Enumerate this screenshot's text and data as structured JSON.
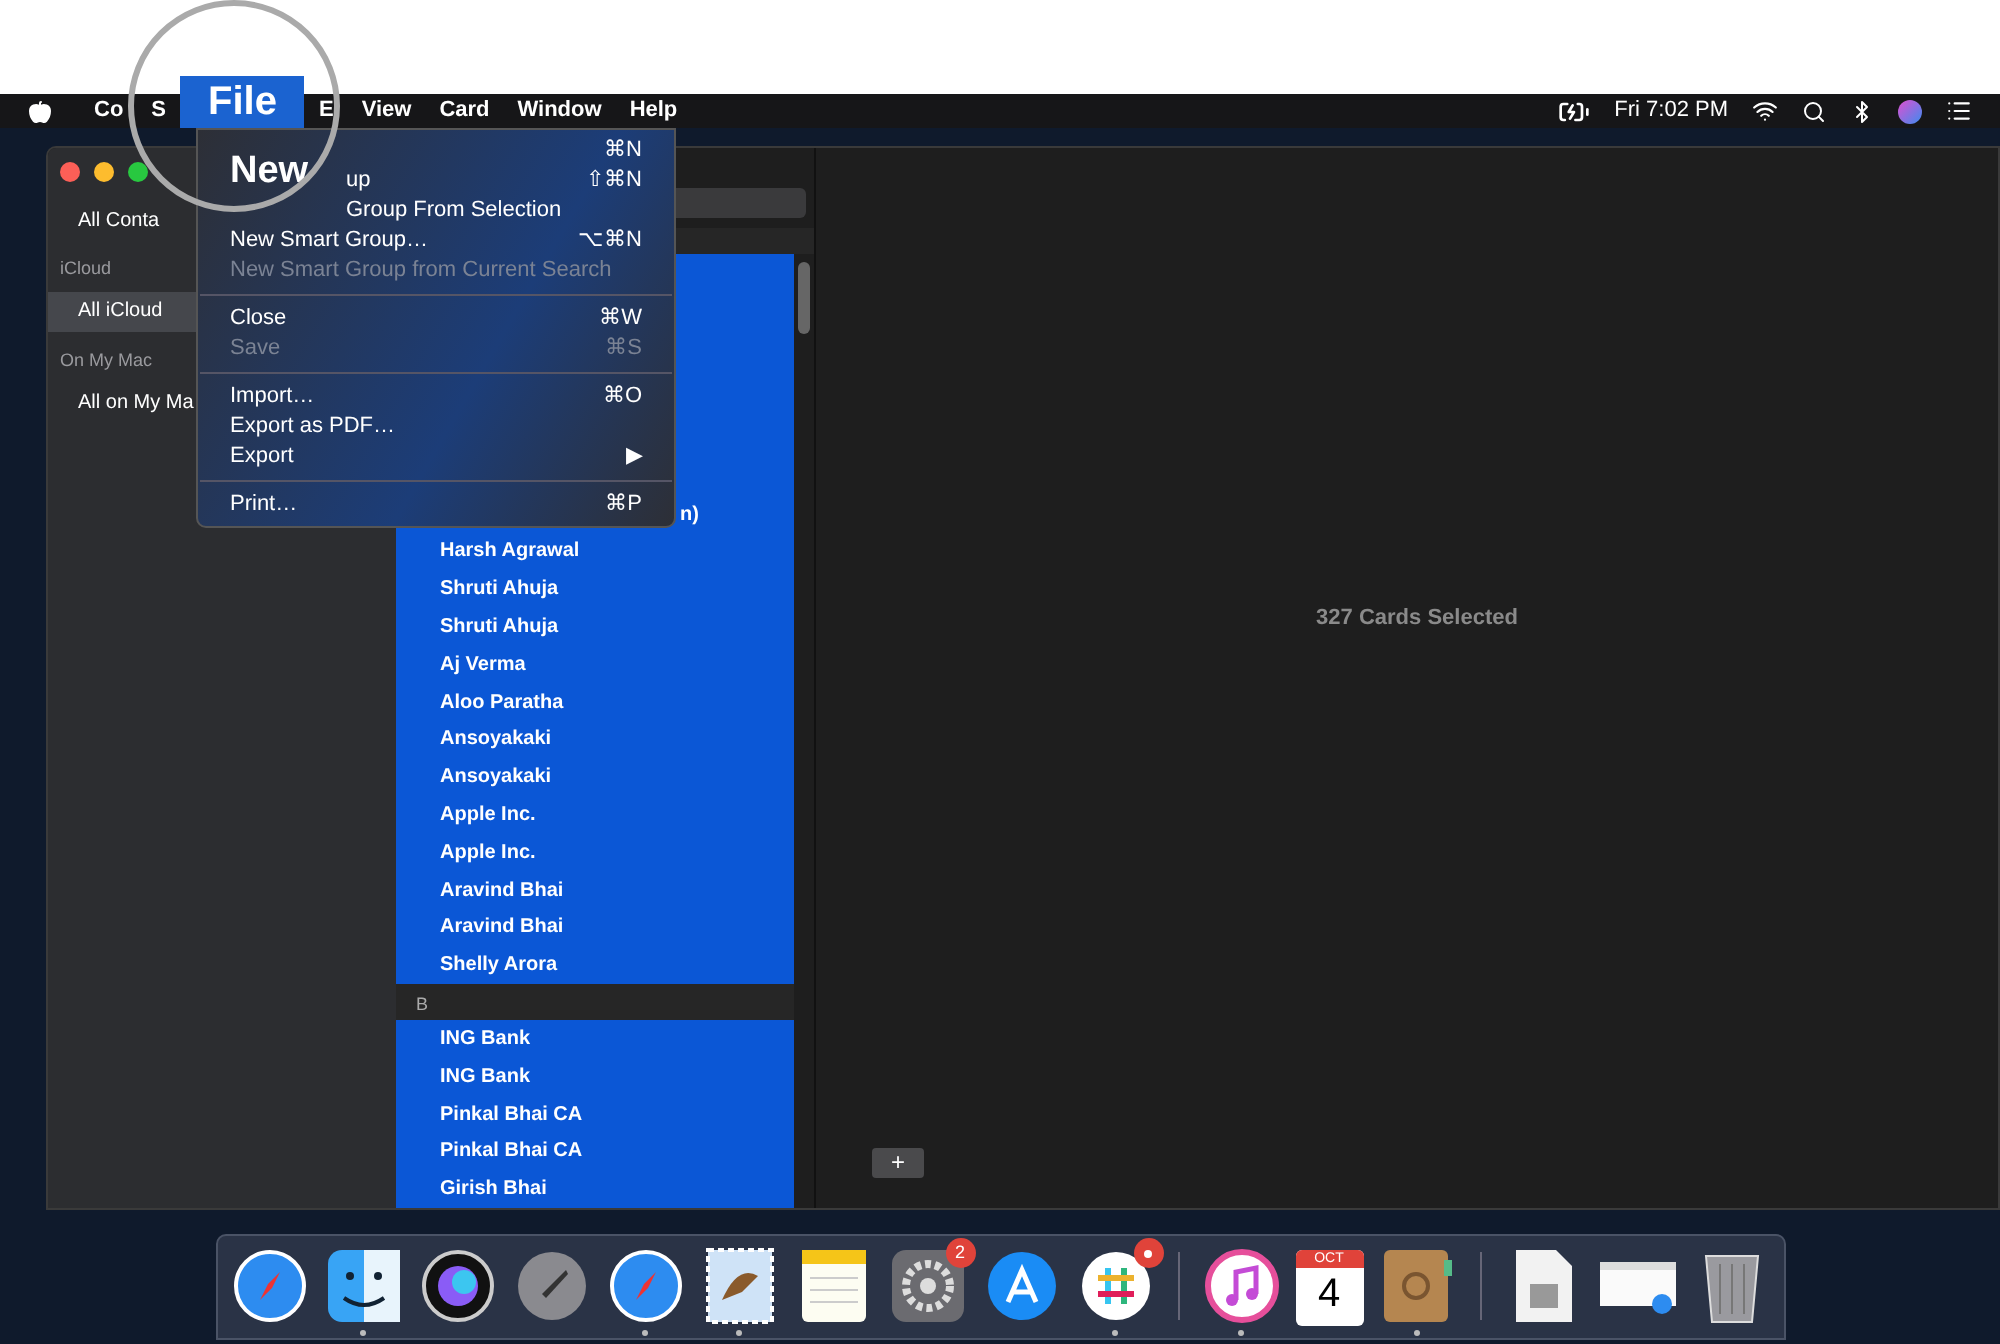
{
  "menu_bar": {
    "items": [
      {
        "label": "Co",
        "selected": false
      },
      {
        "label": "S",
        "selected": false
      },
      {
        "label": "File",
        "selected": true
      },
      {
        "label": "E",
        "selected": false
      },
      {
        "label": "View",
        "selected": false
      },
      {
        "label": "Card",
        "selected": false
      },
      {
        "label": "Window",
        "selected": false
      },
      {
        "label": "Help",
        "selected": false
      }
    ],
    "clock": "Fri 7:02 PM"
  },
  "file_menu": {
    "magnified": "New",
    "items": [
      {
        "kind": "item",
        "shortcut": "⌘N",
        "disabled": false
      },
      {
        "kind": "partial",
        "label": "up",
        "shortcut": "⇧⌘N",
        "disabled": false
      },
      {
        "kind": "partial",
        "label": "Group From Selection",
        "disabled": false
      },
      {
        "kind": "item",
        "label": "New Smart Group…",
        "shortcut": "⌥⌘N",
        "disabled": false
      },
      {
        "kind": "item",
        "label": "New Smart Group from Current Search",
        "disabled": true
      },
      {
        "kind": "separator"
      },
      {
        "kind": "item",
        "label": "Close",
        "shortcut": "⌘W",
        "disabled": false
      },
      {
        "kind": "item",
        "label": "Save",
        "shortcut": "⌘S",
        "disabled": true
      },
      {
        "kind": "separator"
      },
      {
        "kind": "item",
        "label": "Import…",
        "shortcut": "⌘O",
        "disabled": false
      },
      {
        "kind": "item",
        "label": "Export as PDF…",
        "disabled": false
      },
      {
        "kind": "submenu",
        "label": "Export",
        "arrow": "▶",
        "disabled": false
      },
      {
        "kind": "separator"
      },
      {
        "kind": "item",
        "label": "Print…",
        "shortcut": "⌘P",
        "disabled": false
      }
    ]
  },
  "sidebar": {
    "items": [
      {
        "kind": "item",
        "label": "All Conta",
        "selected": false
      },
      {
        "kind": "header",
        "label": "iCloud"
      },
      {
        "kind": "item",
        "label": "All iCloud",
        "selected": true
      },
      {
        "kind": "header",
        "label": "On My Mac"
      },
      {
        "kind": "item",
        "label": "All on My Ma",
        "selected": false
      }
    ]
  },
  "contacts": {
    "rows": [
      {
        "kind": "cut_contact",
        "name": "n)",
        "selected": true
      },
      {
        "kind": "contact",
        "name": "Harsh Agrawal",
        "selected": true
      },
      {
        "kind": "contact",
        "name": "Shruti Ahuja",
        "selected": true
      },
      {
        "kind": "contact",
        "name": "Shruti Ahuja",
        "selected": true
      },
      {
        "kind": "contact",
        "name": "Aj Verma",
        "selected": true
      },
      {
        "kind": "contact",
        "name": "Aloo Paratha",
        "selected": true
      },
      {
        "kind": "contact",
        "name": "Ansoyakaki",
        "selected": true
      },
      {
        "kind": "contact",
        "name": "Ansoyakaki",
        "selected": true
      },
      {
        "kind": "contact",
        "name": "Apple Inc.",
        "selected": true
      },
      {
        "kind": "contact",
        "name": "Apple Inc.",
        "selected": true
      },
      {
        "kind": "contact",
        "name": "Aravind Bhai",
        "selected": true
      },
      {
        "kind": "contact",
        "name": "Aravind Bhai",
        "selected": true
      },
      {
        "kind": "contact",
        "name": "Shelly Arora",
        "selected": true
      },
      {
        "kind": "section",
        "name": "B"
      },
      {
        "kind": "contact",
        "name": "ING Bank",
        "selected": true
      },
      {
        "kind": "contact",
        "name": "ING Bank",
        "selected": true
      },
      {
        "kind": "contact",
        "name": "Pinkal Bhai CA",
        "selected": true
      },
      {
        "kind": "contact",
        "name": "Pinkal Bhai CA",
        "selected": true
      },
      {
        "kind": "contact",
        "name": "Girish Bhai",
        "selected": true
      }
    ]
  },
  "detail": {
    "message": "327 Cards Selected",
    "add_button": "+"
  },
  "dock": {
    "items": [
      {
        "kind": "safari",
        "running": false
      },
      {
        "kind": "finder",
        "running": true
      },
      {
        "kind": "siri",
        "running": false
      },
      {
        "kind": "rocket",
        "running": false
      },
      {
        "kind": "safari",
        "running": true
      },
      {
        "kind": "bird",
        "running": true
      },
      {
        "kind": "notes",
        "running": false
      },
      {
        "kind": "settings",
        "running": false,
        "badge": "2"
      },
      {
        "kind": "store",
        "running": false
      },
      {
        "kind": "slack",
        "running": true,
        "alert": true
      },
      {
        "kind": "divider"
      },
      {
        "kind": "music",
        "running": true
      },
      {
        "kind": "calendar",
        "running": false,
        "month": "OCT",
        "day": "4"
      },
      {
        "kind": "contacts",
        "running": true
      },
      {
        "kind": "divider"
      },
      {
        "kind": "file",
        "running": false
      },
      {
        "kind": "window",
        "running": false
      },
      {
        "kind": "trash",
        "running": false
      }
    ]
  }
}
